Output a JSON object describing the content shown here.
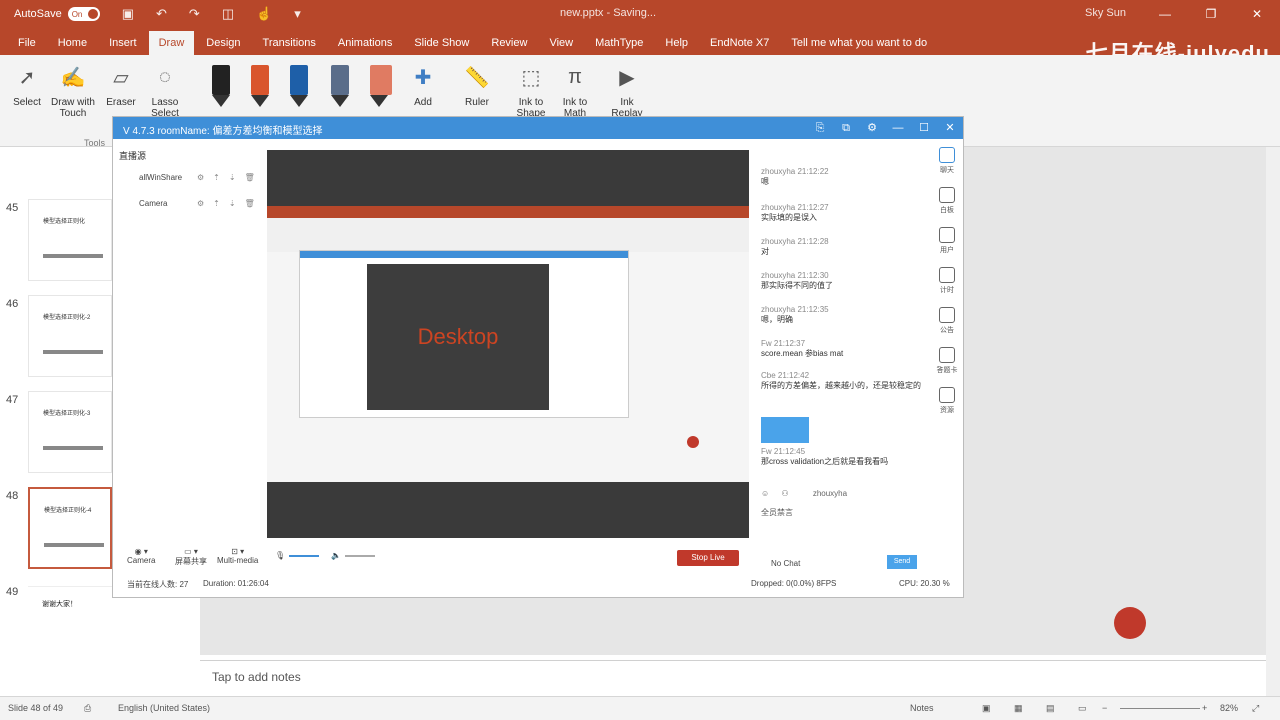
{
  "titlebar": {
    "autosave_label": "AutoSave",
    "autosave_state": "On",
    "document_title": "new.pptx - Saving...",
    "user_name": "Sky Sun",
    "minimize_glyph": "—",
    "restore_glyph": "❐",
    "close_glyph": "✕"
  },
  "ribbon_tabs": [
    "File",
    "Home",
    "Insert",
    "Draw",
    "Design",
    "Transitions",
    "Animations",
    "Slide Show",
    "Review",
    "View",
    "MathType",
    "Help",
    "EndNote X7"
  ],
  "active_tab": "Draw",
  "tell_me": "Tell me what you want to do",
  "watermark": "七月在线-julyedu",
  "ribbon": {
    "select": "Select",
    "draw_with_touch": "Draw with Touch",
    "eraser": "Eraser",
    "lasso_select": "Lasso Select",
    "add": "Add",
    "ruler": "Ruler",
    "ink_to_shape": "Ink to Shape",
    "ink_to_math": "Ink to Math",
    "ink_replay": "Ink Replay",
    "tools_group": "Tools",
    "pen_colors": [
      "#222222",
      "#d9552d",
      "#1e5fa8",
      "#5a6d8a",
      "#e07b62"
    ]
  },
  "slides": {
    "numbers": [
      "45",
      "46",
      "47",
      "48",
      "49"
    ],
    "thumb_titles": [
      "模型选择正则化",
      "模型选择正则化-2",
      "模型选择正则化-3",
      "模型选择正则化-4"
    ],
    "last_thumb_title": "谢谢大家！"
  },
  "notes_placeholder": "Tap to add notes",
  "status": {
    "slide_of": "Slide 48 of 49",
    "language": "English (United States)",
    "notes": "Notes",
    "zoom": "82%"
  },
  "stream_app": {
    "version_title": "V 4.7.3  roomName: 偏差方差均衡和模型选择",
    "source_header": "直播源",
    "sources": [
      "allWinShare",
      "Camera"
    ],
    "desktop_label": "Desktop",
    "chat": [
      {
        "user": "zhouxyha 21:12:22",
        "text": "嗯"
      },
      {
        "user": "zhouxyha 21:12:27",
        "text": "实际填的是误入"
      },
      {
        "user": "zhouxyha 21:12:28",
        "text": "对"
      },
      {
        "user": "zhouxyha 21:12:30",
        "text": "那实际得不同的值了"
      },
      {
        "user": "zhouxyha 21:12:35",
        "text": "嗯，明确"
      },
      {
        "user": "Fw 21:12:37",
        "text": "score.mean 参bias mat"
      },
      {
        "user": "Cbe 21:12:42",
        "text": "所得的方差偏差，越来越小的，还是较稳定的"
      },
      {
        "user": "Fw 21:12:45",
        "text": "那cross validation之后就是看我看吗"
      }
    ],
    "chat_target": "zhouxyha",
    "right_tools": [
      "聊天",
      "白板",
      "用户",
      "计时",
      "公告",
      "答题卡",
      "资源"
    ],
    "bottom": {
      "camera": "Camera",
      "screen_share": "屏幕共享",
      "multimedia": "Multi-media",
      "stop_live": "Stop Live",
      "no_chat": "No Chat",
      "send": "Send",
      "online_count": "当前在线人数: 27",
      "duration": "Duration: 01:26:04",
      "dropped": "Dropped: 0(0.0%)  8FPS",
      "cpu": "CPU: 20.30 %",
      "all_mute": "全员禁言"
    }
  }
}
